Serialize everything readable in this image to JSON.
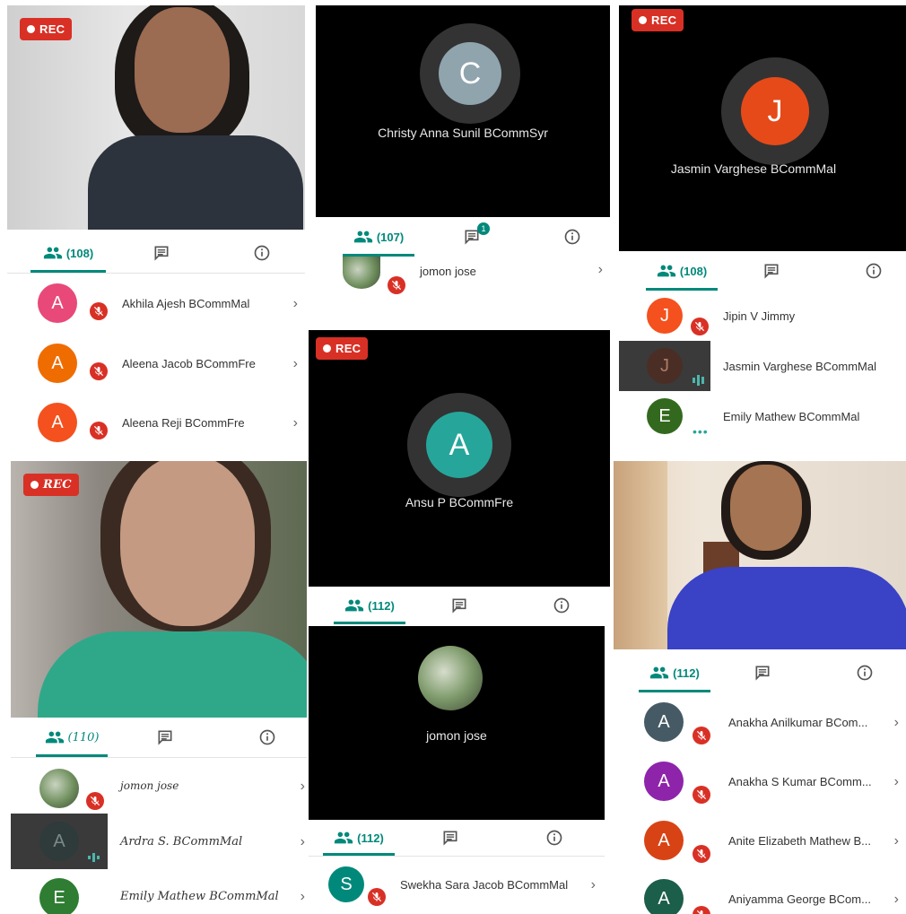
{
  "rec_label": "REC",
  "rec_label_script": "REC",
  "panels": {
    "p1": {
      "count": "(108)",
      "rows": [
        {
          "initial": "A",
          "name": "Akhila Ajesh BCommMal",
          "color": "#e84979"
        },
        {
          "initial": "A",
          "name": "Aleena Jacob BCommFre",
          "color": "#ef6c00"
        },
        {
          "initial": "A",
          "name": "Aleena Reji BCommFre",
          "color": "#f4511e"
        }
      ]
    },
    "p2": {
      "center_initial": "C",
      "center_name": "Christy Anna Sunil BCommSyr",
      "count": "(107)",
      "chat_badge": "1",
      "rows": [
        {
          "name": "jomon jose"
        }
      ]
    },
    "p3": {
      "center_initial": "J",
      "center_name": "Jasmin Varghese BCommMal",
      "count": "(108)",
      "rows": [
        {
          "initial": "J",
          "name": "Jipin V Jimmy",
          "color": "#f4511e"
        },
        {
          "initial": "J",
          "name": "Jasmin Varghese BCommMal",
          "color": "#4a2e25"
        },
        {
          "initial": "E",
          "name": "Emily Mathew BCommMal",
          "color": "#33691e"
        }
      ]
    },
    "p4": {
      "center_initial": "A",
      "center_name": "Ansu P BCommFre",
      "count": "(112)"
    },
    "p5": {
      "count": "(110)",
      "rows": [
        {
          "name": "jomon jose"
        },
        {
          "initial": "A",
          "name": "Ardra S. BCommMal",
          "color": "#2e3b3a"
        },
        {
          "initial": "E",
          "name": "Emily Mathew BCommMal",
          "color": "#2e7d32"
        }
      ]
    },
    "p6": {
      "center_name": "jomon jose",
      "count": "(112)",
      "rows": [
        {
          "initial": "S",
          "name": "Swekha Sara Jacob BCommMal",
          "color": "#00897b"
        }
      ]
    },
    "p7": {
      "count": "(112)",
      "rows": [
        {
          "initial": "A",
          "name": "Anakha Anilkumar BCom...",
          "color": "#455a64"
        },
        {
          "initial": "A",
          "name": "Anakha S Kumar BComm...",
          "color": "#8e24aa"
        },
        {
          "initial": "A",
          "name": "Anite Elizabeth Mathew B...",
          "color": "#d84315"
        },
        {
          "initial": "A",
          "name": "Aniyamma George BCom...",
          "color": "#1b5e4a"
        }
      ]
    }
  },
  "colors": {
    "accent": "#00897b",
    "rec": "#d93025",
    "c_avatar": "#90a4ae",
    "j_avatar": "#e64a19",
    "a_avatar": "#26a69a"
  }
}
